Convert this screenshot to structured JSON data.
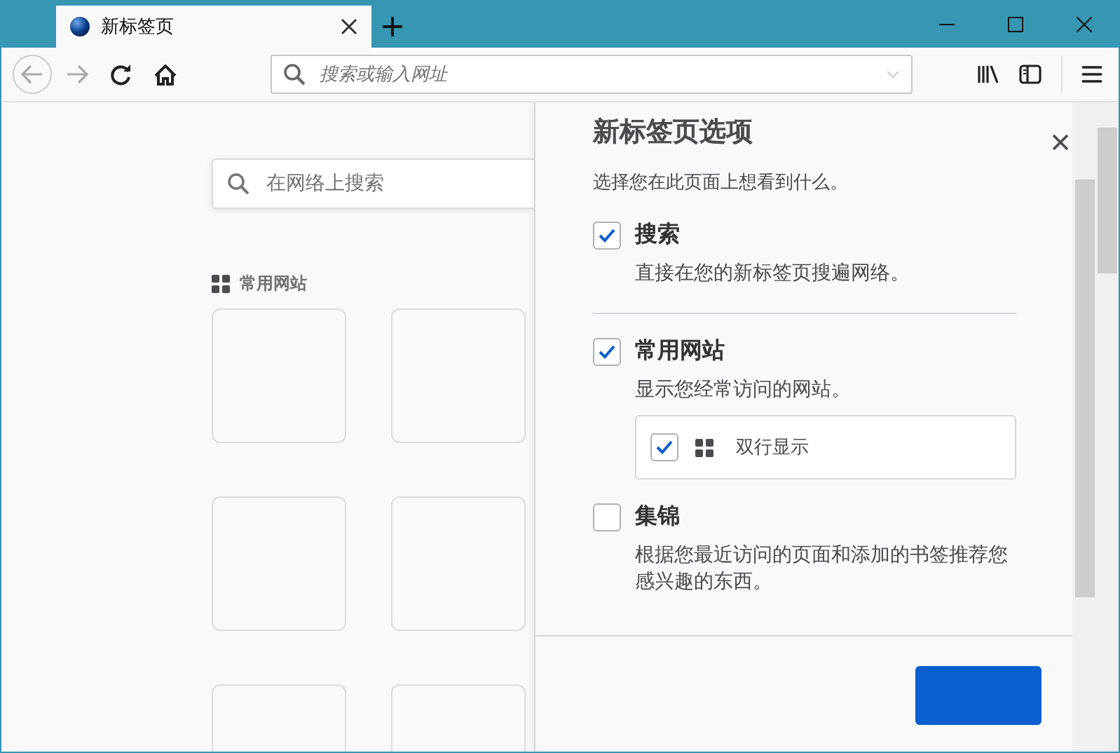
{
  "tabs": [
    {
      "title": "新标签页",
      "selected": true
    }
  ],
  "toolbar": {
    "address_placeholder": "搜索或输入网址"
  },
  "page": {
    "search_placeholder": "在网络上搜索",
    "top_sites_heading": "常用网站"
  },
  "panel": {
    "title": "新标签页选项",
    "subtitle": "选择您在此页面上想看到什么。",
    "sections": [
      {
        "label": "搜索",
        "checked": true,
        "description": "直接在您的新标签页搜遍网络。"
      },
      {
        "label": "常用网站",
        "checked": true,
        "description": "显示您经常访问的网站。",
        "suboption": {
          "label": "双行显示",
          "checked": true
        }
      },
      {
        "label": "集锦",
        "checked": false,
        "description": "根据您最近访问的页面和添加的书签推荐您感兴趣的东西。"
      }
    ]
  }
}
